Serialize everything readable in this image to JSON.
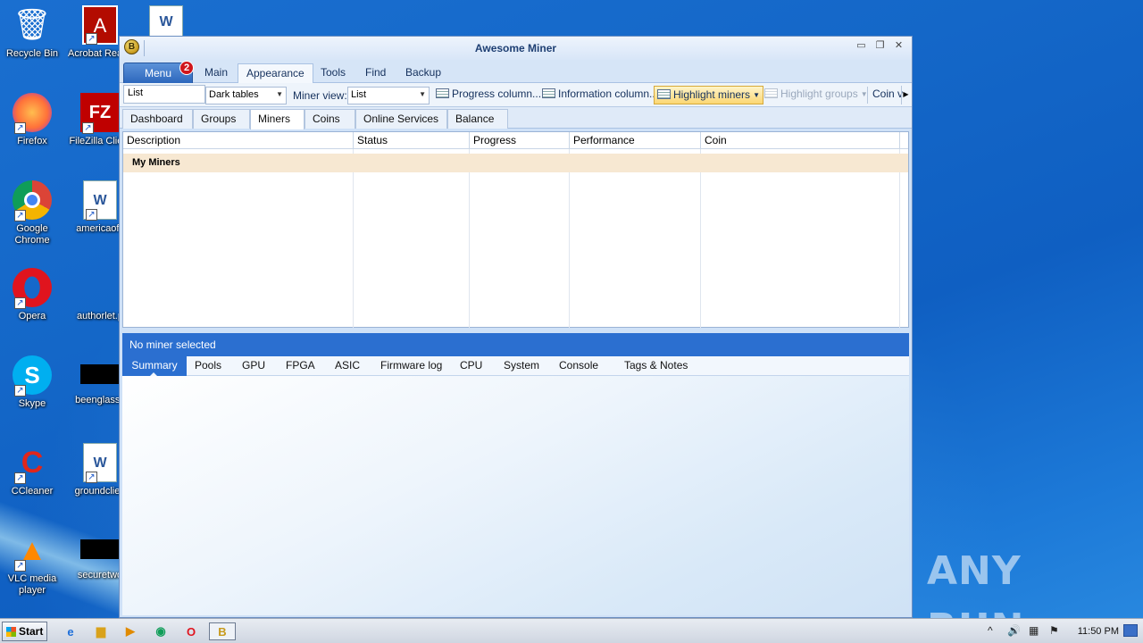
{
  "desktop": {
    "icons": [
      {
        "label": "Recycle Bin",
        "glyph": "🗑"
      },
      {
        "label": "Acrobat Reader DC",
        "glyph": "A"
      },
      {
        "label": "Firefox",
        "glyph": "🦊"
      },
      {
        "label": "FileZilla Client",
        "glyph": "FZ"
      },
      {
        "label": "Google Chrome",
        "glyph": "◉"
      },
      {
        "label": "americaoffi",
        "glyph": "W"
      },
      {
        "label": "Opera",
        "glyph": "O"
      },
      {
        "label": "authorlet.p",
        "glyph": ""
      },
      {
        "label": "Skype",
        "glyph": "S"
      },
      {
        "label": "beenglass.j",
        "glyph": ""
      },
      {
        "label": "CCleaner",
        "glyph": "C"
      },
      {
        "label": "groundclien",
        "glyph": "W"
      },
      {
        "label": "VLC media player",
        "glyph": "▲"
      },
      {
        "label": "securetwo",
        "glyph": ""
      }
    ]
  },
  "window": {
    "title": "Awesome Miner",
    "menu_label": "Menu",
    "menu_badge": "2",
    "ribbon_tabs": [
      "Main",
      "Appearance",
      "Tools",
      "Find",
      "Backup"
    ],
    "active_ribbon_tab": "Appearance",
    "toolbar": {
      "list_value": "List",
      "theme_value": "Dark tables",
      "miner_view_label": "Miner view:",
      "miner_view_value": "List",
      "progress_columns": "Progress column...",
      "information_columns": "Information column...",
      "highlight_miners": "Highlight miners",
      "highlight_groups": "Highlight groups",
      "coin_view": "Coin v"
    },
    "main_tabs": [
      "Dashboard",
      "Groups",
      "Miners",
      "Coins",
      "Online Services",
      "Balance"
    ],
    "active_main_tab": "Miners",
    "grid": {
      "columns": [
        "Description",
        "Status",
        "Progress",
        "Performance",
        "Coin"
      ],
      "group_row": "My Miners"
    },
    "status_text": "No miner selected",
    "detail_tabs": [
      "Summary",
      "Pools",
      "GPU",
      "FPGA",
      "ASIC",
      "Firmware log",
      "CPU",
      "System",
      "Console",
      "Tags & Notes"
    ],
    "active_detail_tab": "Summary"
  },
  "taskbar": {
    "start_label": "Start",
    "clock": "11:50 PM"
  },
  "watermark": "ANY RUN",
  "colors": {
    "accent_blue": "#2b6fd0",
    "highlight_yellow": "#fbd774",
    "group_row": "#f7e8d2",
    "badge_red": "#d0161c"
  }
}
